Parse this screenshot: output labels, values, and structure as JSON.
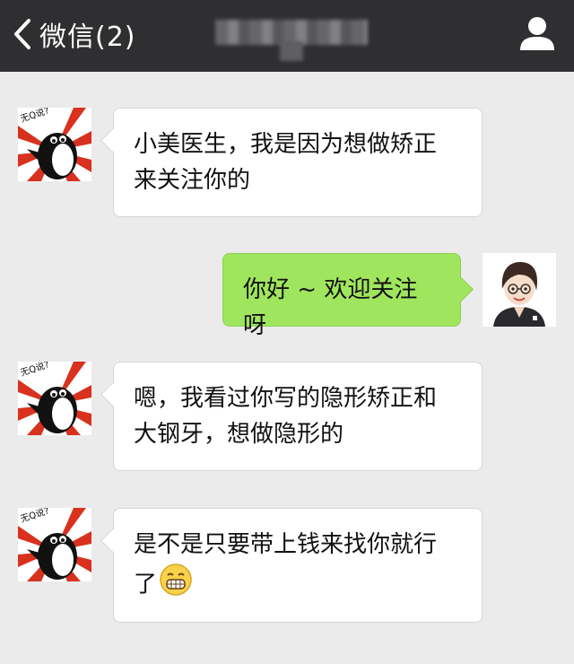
{
  "header": {
    "back_label": "微信(2)",
    "back_icon": "chevron-left-icon",
    "profile_icon": "person-icon"
  },
  "messages": [
    {
      "side": "left",
      "avatar": "penguin-avatar",
      "lines": [
        "小美医生，我是因为想做矫正",
        "来关注你的"
      ]
    },
    {
      "side": "right",
      "avatar": "doctor-avatar",
      "lines": [
        "你好 ~ 欢迎关注呀"
      ]
    },
    {
      "side": "left",
      "avatar": "penguin-avatar",
      "lines": [
        "嗯，我看过你写的隐形矫正和",
        "大钢牙，想做隐形的"
      ]
    },
    {
      "side": "left",
      "avatar": "penguin-avatar",
      "lines": [
        "是不是只要带上钱来找你就行",
        "了"
      ],
      "emoji": "grinning-face-icon"
    }
  ],
  "colors": {
    "header_bg": "#2f2f31",
    "chat_bg": "#ebebeb",
    "bubble_self": "#9fe55d",
    "bubble_other": "#ffffff"
  }
}
